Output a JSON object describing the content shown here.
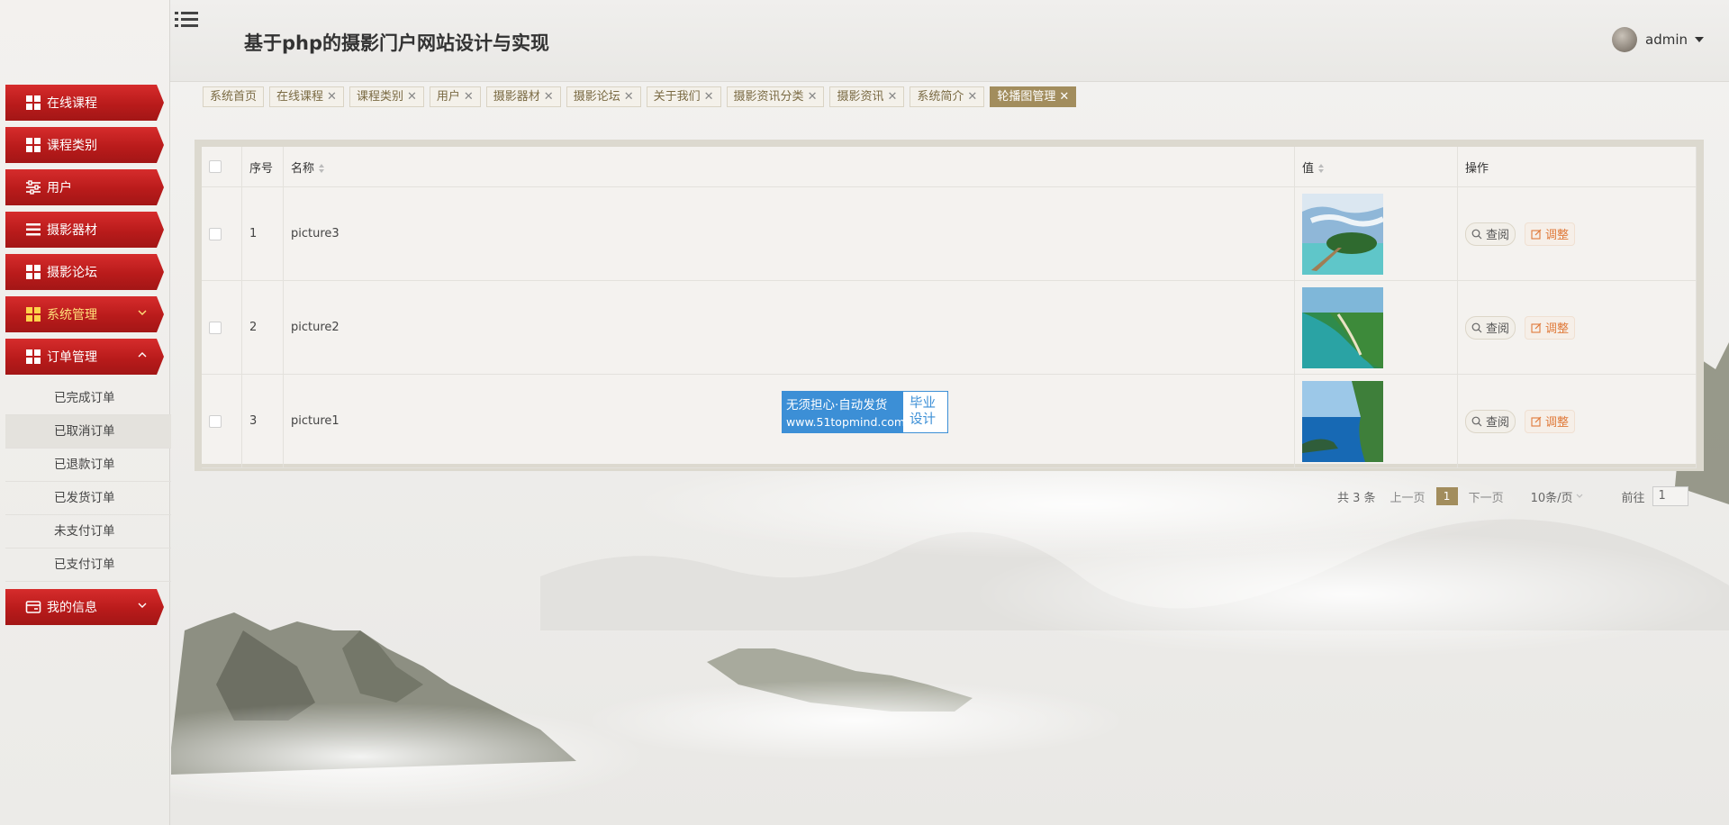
{
  "app": {
    "title": "基于php的摄影门户网站设计与实现"
  },
  "user": {
    "name": "admin"
  },
  "sidebar": {
    "items": [
      {
        "label": "在线课程",
        "icon": "grid-icon",
        "name": "sidebar-item-online-course"
      },
      {
        "label": "课程类别",
        "icon": "grid-icon",
        "name": "sidebar-item-course-category"
      },
      {
        "label": "用户",
        "icon": "sliders-icon",
        "name": "sidebar-item-users"
      },
      {
        "label": "摄影器材",
        "icon": "list-icon",
        "name": "sidebar-item-equipment"
      },
      {
        "label": "摄影论坛",
        "icon": "grid-icon",
        "name": "sidebar-item-forum"
      },
      {
        "label": "系统管理",
        "icon": "grid-icon",
        "name": "sidebar-item-system",
        "caret": "down",
        "highlight": true
      },
      {
        "label": "订单管理",
        "icon": "grid-icon",
        "name": "sidebar-item-orders",
        "caret": "up"
      }
    ],
    "submenu": [
      {
        "label": "已完成订单"
      },
      {
        "label": "已取消订单"
      },
      {
        "label": "已退款订单"
      },
      {
        "label": "已发货订单"
      },
      {
        "label": "未支付订单"
      },
      {
        "label": "已支付订单"
      }
    ],
    "last_item": {
      "label": "我的信息",
      "icon": "card-icon",
      "caret": "down"
    }
  },
  "tabs": [
    {
      "label": "系统首页",
      "closable": false
    },
    {
      "label": "在线课程",
      "closable": true
    },
    {
      "label": "课程类别",
      "closable": true
    },
    {
      "label": "用户",
      "closable": true
    },
    {
      "label": "摄影器材",
      "closable": true
    },
    {
      "label": "摄影论坛",
      "closable": true
    },
    {
      "label": "关于我们",
      "closable": true
    },
    {
      "label": "摄影资讯分类",
      "closable": true
    },
    {
      "label": "摄影资讯",
      "closable": true
    },
    {
      "label": "系统简介",
      "closable": true
    },
    {
      "label": "轮播图管理",
      "closable": true,
      "active": true
    }
  ],
  "table": {
    "columns": {
      "index": "序号",
      "name": "名称",
      "value": "值",
      "actions": "操作"
    },
    "rows": [
      {
        "index": "1",
        "name": "picture3",
        "image": "island-pier"
      },
      {
        "index": "2",
        "name": "picture2",
        "image": "green-coast"
      },
      {
        "index": "3",
        "name": "picture1",
        "image": "blue-cliff"
      }
    ],
    "view_label": "查阅",
    "edit_label": "调整"
  },
  "pager": {
    "total": "共 3 条",
    "prev": "上一页",
    "current": "1",
    "next": "下一页",
    "size": "10条/页",
    "goto": "前往",
    "goto_value": "1"
  },
  "watermark": {
    "line1": "无须担心·自动发货",
    "line2": "www.51topmind.com",
    "right": "毕业设计"
  },
  "colors": {
    "menu_red": "#c0201f",
    "accent_gold": "#a28d5d",
    "edit_orange": "#e07a3a",
    "watermark_blue": "#3c8fd6"
  }
}
